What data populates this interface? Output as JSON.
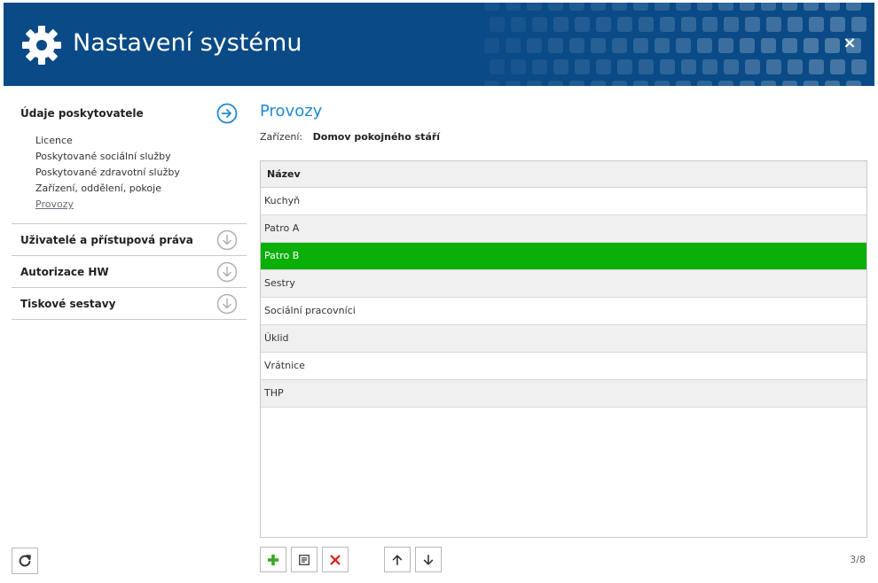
{
  "window": {
    "title": "Nastavení systému",
    "close_label": "×"
  },
  "sidebar": {
    "sections": [
      {
        "label": "Údaje poskytovatele",
        "expanded": true,
        "items": [
          {
            "label": "Licence"
          },
          {
            "label": "Poskytované sociální služby"
          },
          {
            "label": "Poskytované zdravotní služby"
          },
          {
            "label": "Zařízení, oddělení, pokoje"
          },
          {
            "label": "Provozy",
            "active": true
          }
        ]
      },
      {
        "label": "Uživatelé a přístupová práva",
        "expanded": false
      },
      {
        "label": "Autorizace HW",
        "expanded": false
      },
      {
        "label": "Tiskové sestavy",
        "expanded": false
      }
    ]
  },
  "main": {
    "title": "Provozy",
    "facility_label": "Zařízení:",
    "facility_value": "Domov pokojného stáří",
    "table": {
      "header": "Název",
      "rows": [
        "Kuchyň",
        "Patro A",
        "Patro B",
        "Sestry",
        "Sociální pracovníci",
        "Úklid",
        "Vrátnice",
        "THP"
      ],
      "selected_index": 2
    },
    "pagination": "3/8"
  },
  "colors": {
    "header_bg": "#0a4a86",
    "accent": "#1f8ad6",
    "selected_row": "#0aaf0a",
    "add_icon": "#3aa51e",
    "delete_icon": "#e02020"
  }
}
